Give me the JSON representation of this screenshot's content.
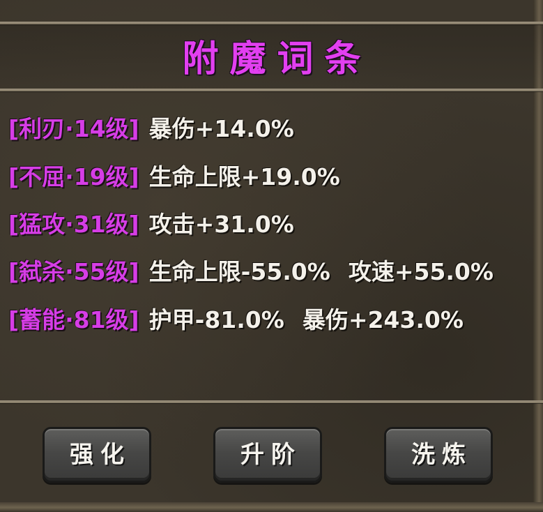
{
  "panel": {
    "title": "附魔词条"
  },
  "affixes": [
    {
      "tag": "[利刃·14级]",
      "effects": [
        "暴伤+14.0%"
      ]
    },
    {
      "tag": "[不屈·19级]",
      "effects": [
        "生命上限+19.0%"
      ]
    },
    {
      "tag": "[猛攻·31级]",
      "effects": [
        "攻击+31.0%"
      ]
    },
    {
      "tag": "[弑杀·55级]",
      "effects": [
        "生命上限-55.0%",
        "攻速+55.0%"
      ]
    },
    {
      "tag": "[蓄能·81级]",
      "effects": [
        "护甲-81.0%",
        "暴伤+243.0%"
      ]
    }
  ],
  "buttons": {
    "enhance": "强化",
    "upgrade": "升阶",
    "reroll": "洗炼"
  },
  "colors": {
    "title": "#e23ff0",
    "tag": "#d63de6",
    "text": "#f4f1ea",
    "panel": "#3c362c",
    "button": "#474746"
  }
}
